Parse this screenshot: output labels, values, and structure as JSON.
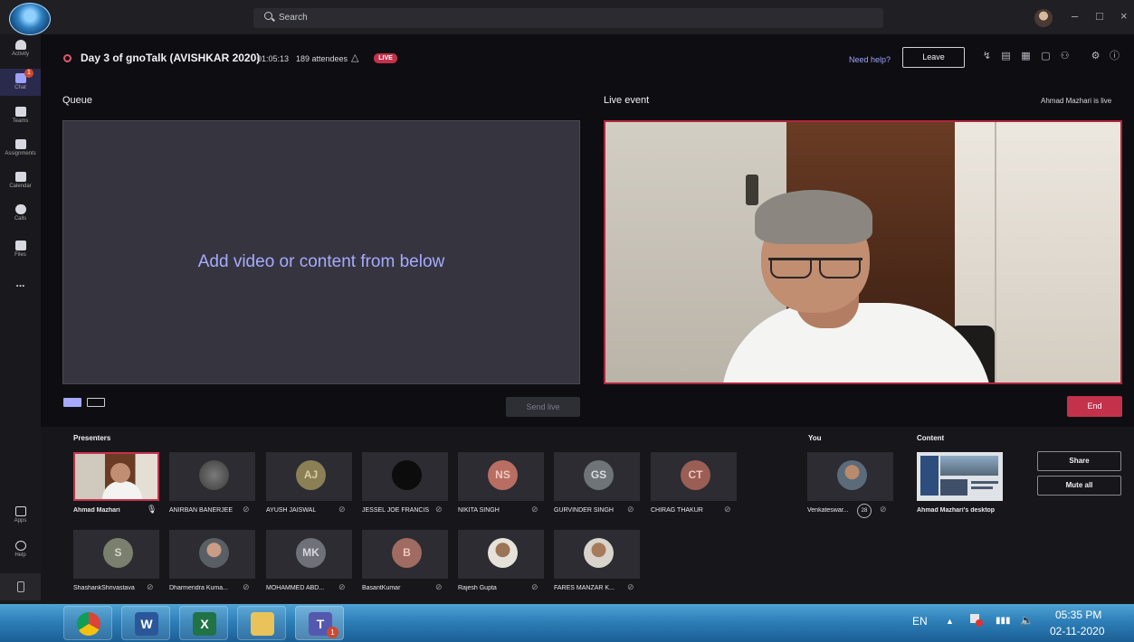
{
  "topbar": {
    "search_placeholder": "Search",
    "back_icon": "chevron-left-icon",
    "forward_icon": "chevron-right-icon",
    "minimize": "–",
    "maximize": "□",
    "close": "×"
  },
  "rail": {
    "items": [
      {
        "label": "Activity",
        "icon": "bell-icon"
      },
      {
        "label": "Chat",
        "icon": "chat-icon",
        "badge": "1"
      },
      {
        "label": "Teams",
        "icon": "teams-icon"
      },
      {
        "label": "Assignments",
        "icon": "assignments-icon"
      },
      {
        "label": "Calendar",
        "icon": "calendar-icon"
      },
      {
        "label": "Calls",
        "icon": "phone-icon"
      },
      {
        "label": "Files",
        "icon": "file-icon"
      },
      {
        "label": "...",
        "icon": "more-icon"
      }
    ],
    "bottom": [
      {
        "label": "Apps",
        "icon": "apps-icon"
      },
      {
        "label": "Help",
        "icon": "help-icon"
      }
    ]
  },
  "header": {
    "title": "Day 3 of gnoTalk (AVISHKAR 2020)",
    "elapsed": "01:05:13",
    "attendees": "189 attendees",
    "live_badge": "LIVE",
    "need_help": "Need help?",
    "leave": "Leave"
  },
  "queue": {
    "label": "Queue",
    "message": "Add video or content from below",
    "send_live": "Send live"
  },
  "live_event": {
    "label": "Live event",
    "status": "Ahmad Mazhari is live",
    "end": "End"
  },
  "presenters": {
    "label": "Presenters",
    "row1": [
      {
        "name": "Ahmad Mazhari",
        "initials": "",
        "color": "#2c2c32"
      },
      {
        "name": "ANIRBAN BANERJEE",
        "initials": "",
        "color": "#2c2c32"
      },
      {
        "name": "AYUSH JAISWAL",
        "initials": "AJ",
        "color": "#8a7f55"
      },
      {
        "name": "JESSEL JOE FRANCIS",
        "initials": "",
        "color": "#0c0c0c"
      },
      {
        "name": "NIKITA SINGH",
        "initials": "NS",
        "color": "#b86e62"
      },
      {
        "name": "GURVINDER SINGH",
        "initials": "GS",
        "color": "#6e7478"
      },
      {
        "name": "CHIRAG THAKUR",
        "initials": "CT",
        "color": "#9a5e55"
      }
    ],
    "row2": [
      {
        "name": "ShashankShrivastava",
        "initials": "S",
        "color": "#7a7f6e"
      },
      {
        "name": "Dharmendra Kuma...",
        "initials": "",
        "color": "#5a5f66"
      },
      {
        "name": "MOHAMMED ABD...",
        "initials": "MK",
        "color": "#6e7178"
      },
      {
        "name": "BasantKumar",
        "initials": "B",
        "color": "#a06b60"
      },
      {
        "name": "Rajesh Gupta",
        "initials": "",
        "color": "#56524c"
      },
      {
        "name": "FARES MANZAR K...",
        "initials": "",
        "color": "#5c5a56"
      }
    ]
  },
  "you": {
    "label": "You",
    "name": "Venkateswar...",
    "count": "28"
  },
  "content": {
    "label": "Content",
    "name": "Ahmad Mazhari's desktop",
    "share": "Share",
    "mute_all": "Mute all"
  },
  "taskbar": {
    "lang": "EN",
    "time": "05:35 PM",
    "date": "02-11-2020",
    "teams_badge": "1"
  }
}
